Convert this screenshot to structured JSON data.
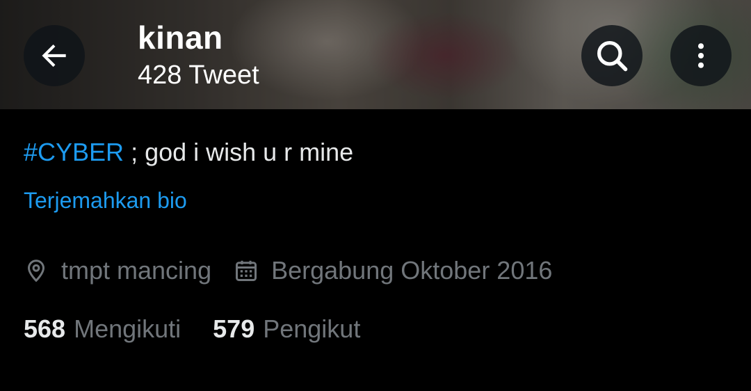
{
  "header": {
    "name": "kinan",
    "tweet_count": "428 Tweet",
    "back_icon": "arrow-left-icon",
    "search_icon": "search-icon",
    "more_icon": "more-vertical-icon"
  },
  "bio": {
    "hashtag": "#CYBER",
    "text": " ; god i wish u r mine",
    "translate_label": "Terjemahkan bio"
  },
  "meta": {
    "location_icon": "location-pin-icon",
    "location": "tmpt mancing",
    "joined_icon": "calendar-icon",
    "joined": "Bergabung Oktober 2016"
  },
  "follow": {
    "following_count": "568",
    "following_label": "Mengikuti",
    "followers_count": "579",
    "followers_label": "Pengikut"
  },
  "colors": {
    "background": "#000000",
    "accent": "#1d9bf0",
    "text_primary": "#e7e9ea",
    "text_secondary": "#71767b"
  }
}
